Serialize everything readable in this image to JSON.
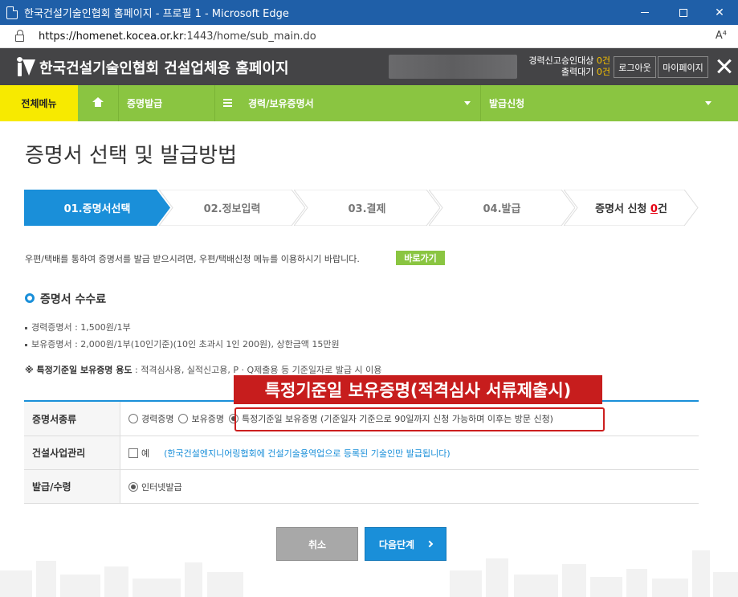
{
  "window": {
    "title": "한국건설기술인협회 홈페이지 - 프로필 1 - Microsoft Edge"
  },
  "browser": {
    "url_host": "https://homenet.kocea.or.kr",
    "url_path": ":1443/home/sub_main.do",
    "read_aloud": "A⁴"
  },
  "header": {
    "site_title": "한국건설기술인협회 건설업체용 홈페이지",
    "status_line1_label": "경력신고승인대상",
    "status_line1_count": "0건",
    "status_line2_label": "출력대기",
    "status_line2_count": "0건",
    "logout_label": "로그아웃",
    "mypage_label": "마이페이지"
  },
  "nav": {
    "all_menu": "전체메뉴",
    "item1": "증명발급",
    "item2": "경력/보유증명서",
    "item3": "발급신청"
  },
  "page": {
    "title": "증명서 선택 및 발급방법"
  },
  "steps": {
    "step1": "01.증명서선택",
    "step2": "02.정보입력",
    "step3": "03.결제",
    "step4": "04.발급",
    "count_prefix": "증명서 신청 ",
    "count_num": "0",
    "count_suffix": "건"
  },
  "info": {
    "notice": "우편/택배를 통하여 증명서를 발급 받으시려면, 우편/택배신청 메뉴를 이용하시기 바랍니다.",
    "go_button": "바로가기",
    "fee_title": "증명서 수수료",
    "fee1": "경력증명서 : 1,500원/1부",
    "fee2": "보유증명서 : 2,000원/1부(10인기준)(10인 초과시 1인 200원), 상한금액 15만원",
    "note_bold": "※ 특정기준일 보유증명 용도",
    "note_rest": " : 적격심사용, 실적신고용, P · Q제출용 등 기준일자로 발급 시 이용"
  },
  "form": {
    "row1_label": "증명서종류",
    "opt1": "경력증명",
    "opt2": "보유증명",
    "opt3": "특정기준일 보유증명 (기준일자 기준으로 90일까지 신청 가능하며 이후는 방문 신청)",
    "row2_label": "건설사업관리",
    "checkbox_label": "예",
    "row2_hint": "(한국건설엔지니어링협회에 건설기술용역업으로 등록된 기술인만 발급됩니다)",
    "row3_label": "발급/수령",
    "opt_internet": "인터넷발급"
  },
  "callout": {
    "label": "특정기준일 보유증명(적격심사 서류제출시)",
    "color": "#c71d1d"
  },
  "buttons": {
    "cancel": "취소",
    "next": "다음단계"
  },
  "colors": {
    "accent_blue": "#1a8fd9",
    "nav_green": "#8ac541",
    "nav_yellow": "#f7ea00",
    "header_gray": "#444446"
  }
}
